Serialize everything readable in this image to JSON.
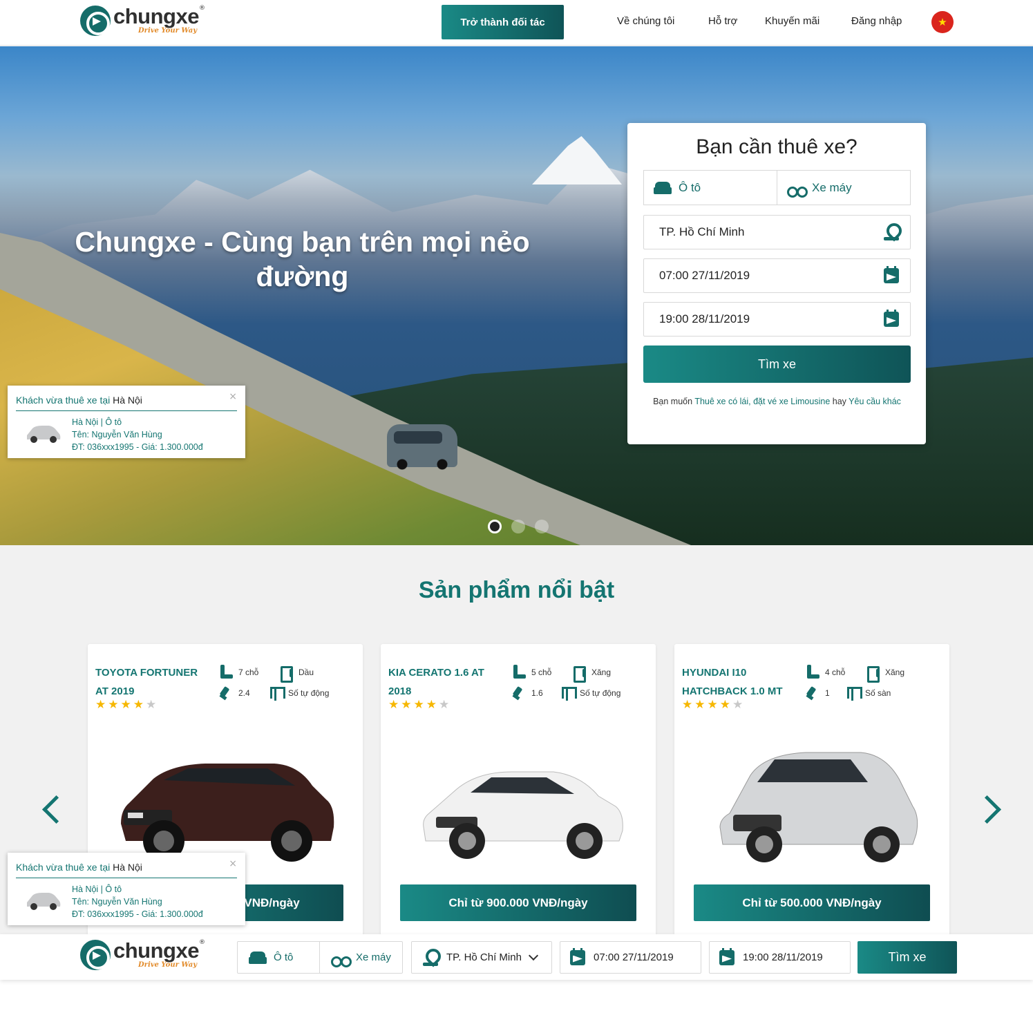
{
  "header": {
    "logo_name": "chungxe",
    "logo_reg": "®",
    "logo_tagline": "Drive Your Way",
    "partner_button": "Trở thành đối tác",
    "nav": [
      "Về chúng tôi",
      "Hỗ trợ",
      "Khuyến mãi",
      "Đăng nhập"
    ],
    "language": "★"
  },
  "hero": {
    "title": "Chungxe - Cùng bạn trên mọi nẻo đường",
    "slides": 3,
    "active_slide": 1
  },
  "search": {
    "title": "Bạn cần thuê xe?",
    "type_car": "Ô tô",
    "type_moto": "Xe máy",
    "city": "TP. Hồ Chí Minh",
    "start": "07:00 27/11/2019",
    "end": "19:00 28/11/2019",
    "button": "Tìm xe",
    "note_prefix": "Bạn muốn ",
    "note_link1": "Thuê xe có lái, đặt vé xe Limousine",
    "note_mid": " hay ",
    "note_link2": "Yêu cầu khác"
  },
  "featured": {
    "title": "Sản phẩm nổi bật",
    "cars": [
      {
        "name": "TOYOTA FORTUNER AT 2019",
        "seats": "7 chỗ",
        "fuel": "Dầu",
        "engine": "2.4",
        "gearbox": "Số tự động",
        "rating": 4,
        "price": "Chỉ từ 1.300.000 VNĐ/ngày"
      },
      {
        "name": "KIA CERATO 1.6 AT 2018",
        "seats": "5 chỗ",
        "fuel": "Xăng",
        "engine": "1.6",
        "gearbox": "Số tự động",
        "rating": 4,
        "price": "Chỉ từ 900.000 VNĐ/ngày"
      },
      {
        "name": "HYUNDAI I10 HATCHBACK 1.0 MT",
        "seats": "4 chỗ",
        "fuel": "Xăng",
        "engine": "1",
        "gearbox": "Số sàn",
        "rating": 4,
        "price": "Chỉ từ 500.000 VNĐ/ngày"
      }
    ]
  },
  "toast": {
    "heading": "Khách vừa thuê xe tại",
    "city": "Hà Nội",
    "line1": "Hà Nội | Ô tô",
    "line2": "Tên: Nguyễn Văn Hùng",
    "line3": "ĐT: 036xxx1995 - Giá: 1.300.000đ",
    "close": "×"
  },
  "bottombar": {
    "type_car": "Ô tô",
    "type_moto": "Xe máy",
    "city": "TP. Hồ Chí Minh",
    "start": "07:00 27/11/2019",
    "end": "19:00 28/11/2019",
    "button": "Tìm xe"
  },
  "colors": {
    "brand": "#147571",
    "accent": "#f6b700"
  }
}
